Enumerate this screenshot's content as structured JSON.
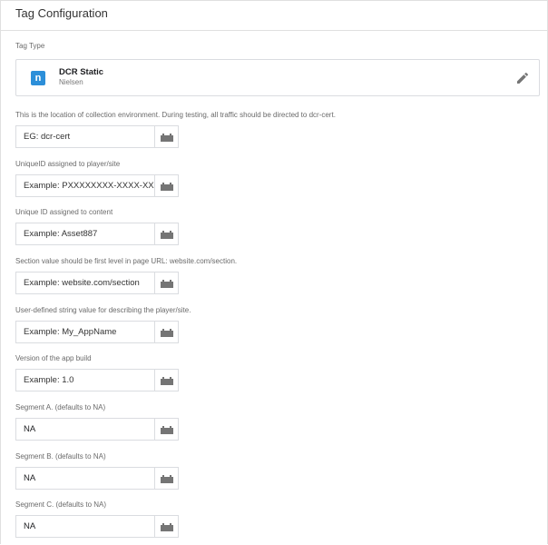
{
  "header": {
    "title": "Tag Configuration"
  },
  "tag_type": {
    "label": "Tag Type",
    "icon_text": "n",
    "name": "DCR Static",
    "vendor": "Nielsen",
    "icon_color": "#2c8fd9"
  },
  "fields": [
    {
      "label": "This is the location of collection environment. During testing, all traffic should be directed to dcr-cert.",
      "value": "",
      "placeholder": "EG: dcr-cert"
    },
    {
      "label": "UniqueID assigned to player/site",
      "value": "",
      "placeholder": "Example: PXXXXXXXX-XXXX-XXXX"
    },
    {
      "label": "Unique ID assigned to content",
      "value": "",
      "placeholder": "Example: Asset887"
    },
    {
      "label": "Section value should be first level in page URL: website.com/section.",
      "value": "",
      "placeholder": "Example: website.com/section"
    },
    {
      "label": "User-defined string value for describing the player/site.",
      "value": "",
      "placeholder": "Example: My_AppName"
    },
    {
      "label": "Version of the app build",
      "value": "",
      "placeholder": "Example: 1.0"
    },
    {
      "label": "Segment A. (defaults to NA)",
      "value": "NA",
      "placeholder": ""
    },
    {
      "label": "Segment B. (defaults to NA)",
      "value": "NA",
      "placeholder": ""
    },
    {
      "label": "Segment C. (defaults to NA)",
      "value": "NA",
      "placeholder": ""
    }
  ]
}
